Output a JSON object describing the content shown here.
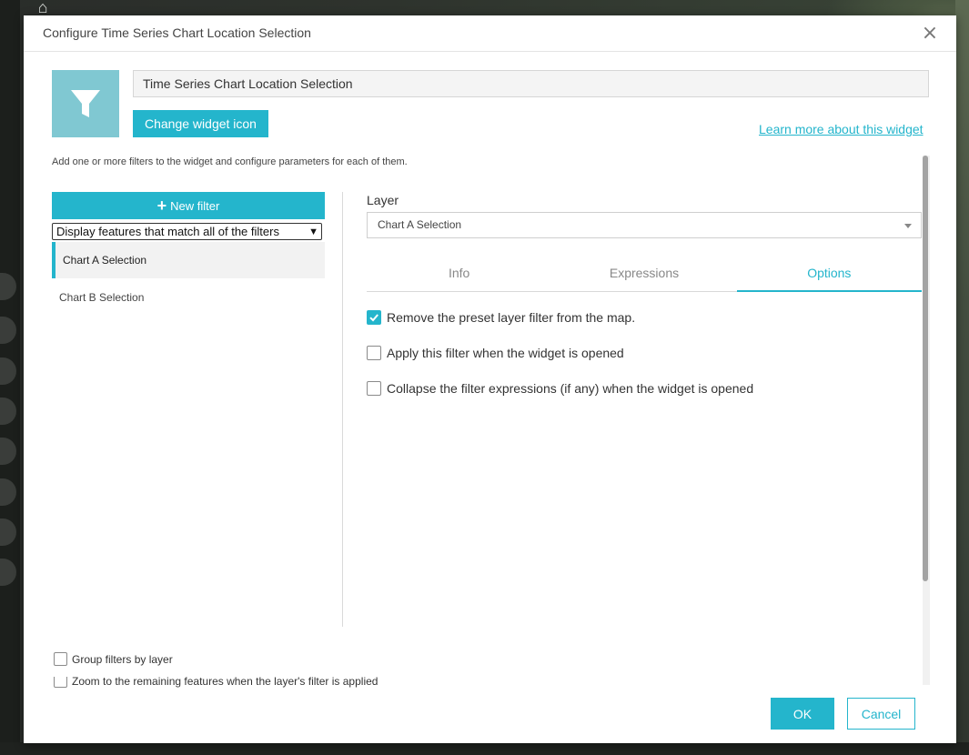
{
  "dialog": {
    "title": "Configure Time Series Chart Location Selection",
    "close_icon": "close-icon"
  },
  "widget": {
    "icon": "filter-funnel-icon",
    "name_value": "Time Series Chart Location Selection",
    "change_icon_label": "Change widget icon",
    "learn_more_label": "Learn more about this widget",
    "hint": "Add one or more filters to the widget and configure parameters for each of them."
  },
  "filters": {
    "new_filter_label": "New filter",
    "match_mode": "Display features that match all of the filters",
    "items": [
      {
        "label": "Chart A Selection",
        "active": true
      },
      {
        "label": "Chart B Selection",
        "active": false
      }
    ]
  },
  "layer": {
    "label": "Layer",
    "selected": "Chart A Selection"
  },
  "tabs": [
    {
      "label": "Info",
      "active": false
    },
    {
      "label": "Expressions",
      "active": false
    },
    {
      "label": "Options",
      "active": true
    }
  ],
  "options": [
    {
      "label": "Remove the preset layer filter from the map.",
      "checked": true
    },
    {
      "label": "Apply this filter when the widget is opened",
      "checked": false
    },
    {
      "label": "Collapse the filter expressions (if any) when the widget is opened",
      "checked": false
    }
  ],
  "bottom_options": [
    {
      "label": "Group filters by layer",
      "checked": false
    },
    {
      "label": "Zoom to the remaining features when the layer's filter is applied",
      "checked": false
    }
  ],
  "footer": {
    "ok_label": "OK",
    "cancel_label": "Cancel"
  },
  "colors": {
    "accent": "#24b5cc",
    "icon_tile": "#80c8d2"
  }
}
